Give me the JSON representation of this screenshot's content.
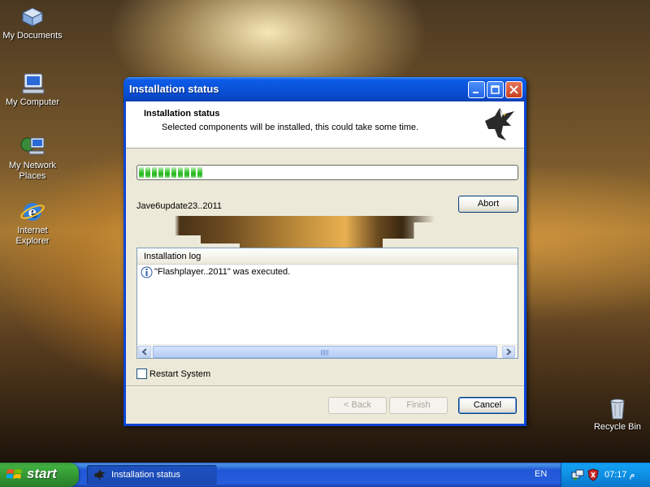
{
  "desktop": {
    "icons": [
      {
        "label": "My Documents"
      },
      {
        "label": "My Computer"
      },
      {
        "label": "My Network Places"
      },
      {
        "label": "Internet Explorer"
      },
      {
        "label": "Recycle Bin"
      }
    ]
  },
  "window": {
    "title": "Installation status",
    "header_title": "Installation status",
    "header_subtitle": "Selected components will be installed, this could take some time.",
    "progress_fraction": 0.18,
    "current_file": "Jave6update23..2011",
    "abort_label": "Abort",
    "log": {
      "header": "Installation log",
      "entries": [
        {
          "icon": "info-icon",
          "text": "\"Flashplayer..2011\" was executed."
        }
      ]
    },
    "restart_label": "Restart System",
    "restart_checked": false,
    "back_label": "< Back",
    "finish_label": "Finish",
    "cancel_label": "Cancel"
  },
  "taskbar": {
    "start_label": "start",
    "task_label": "Installation status",
    "language": "EN",
    "clock": "07:17 م"
  },
  "colors": {
    "titlebar": "#0a53d8",
    "progress_green": "#24b51c",
    "taskbar": "#245ddb",
    "start_green": "#3fae3f"
  }
}
